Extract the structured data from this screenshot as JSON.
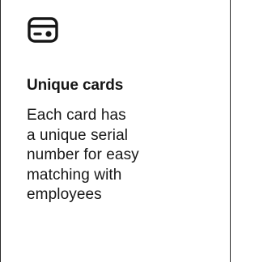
{
  "feature": {
    "icon": "credit-card-icon",
    "title": "Unique cards",
    "description": "Each card has\na unique serial\nnumber for easy\nmatching with\nemployees"
  },
  "colors": {
    "text": "#161616",
    "border": "#2b2b2b",
    "background": "#ffffff"
  }
}
